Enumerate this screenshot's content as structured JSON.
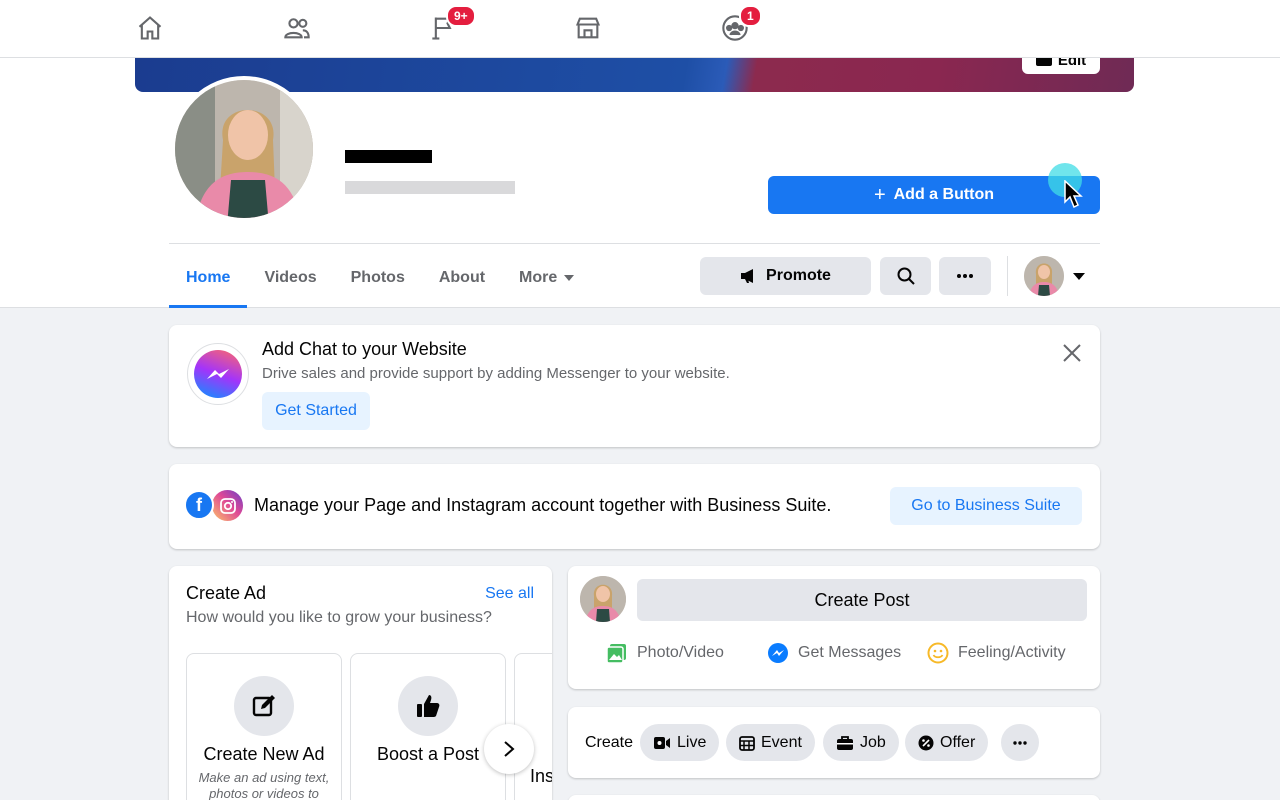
{
  "topnav": {
    "items": [
      {
        "icon": "home-icon",
        "badge": ""
      },
      {
        "icon": "people-icon",
        "badge": ""
      },
      {
        "icon": "flag-icon",
        "badge": "9+"
      },
      {
        "icon": "store-icon",
        "badge": ""
      },
      {
        "icon": "groups-icon",
        "badge": "1"
      }
    ]
  },
  "header": {
    "edit_cover_label": "Edit",
    "add_button_label": "Add a Button",
    "tabs": [
      "Home",
      "Videos",
      "Photos",
      "About",
      "More"
    ],
    "promote_label": "Promote"
  },
  "chat_card": {
    "title": "Add Chat to your Website",
    "subtitle": "Drive sales and provide support by adding Messenger to your website.",
    "cta": "Get Started"
  },
  "suite_card": {
    "text": "Manage your Page and Instagram account together with Business Suite.",
    "cta": "Go to Business Suite"
  },
  "ad_card": {
    "title": "Create Ad",
    "subtitle": "How would you like to grow your business?",
    "see_all": "See all",
    "tiles": [
      {
        "label": "Create New Ad",
        "desc": "Make an ad using text, photos or videos to"
      },
      {
        "label": "Boost a Post",
        "desc": ""
      },
      {
        "label": "Ins",
        "desc": ""
      }
    ]
  },
  "post_card": {
    "create_post": "Create Post",
    "actions": [
      "Photo/Video",
      "Get Messages",
      "Feeling/Activity"
    ]
  },
  "create_card": {
    "label": "Create",
    "pills": [
      "Live",
      "Event",
      "Job",
      "Offer"
    ]
  },
  "colors": {
    "accent": "#1877f2",
    "badge": "#e41e3f",
    "background": "#f0f2f5"
  }
}
